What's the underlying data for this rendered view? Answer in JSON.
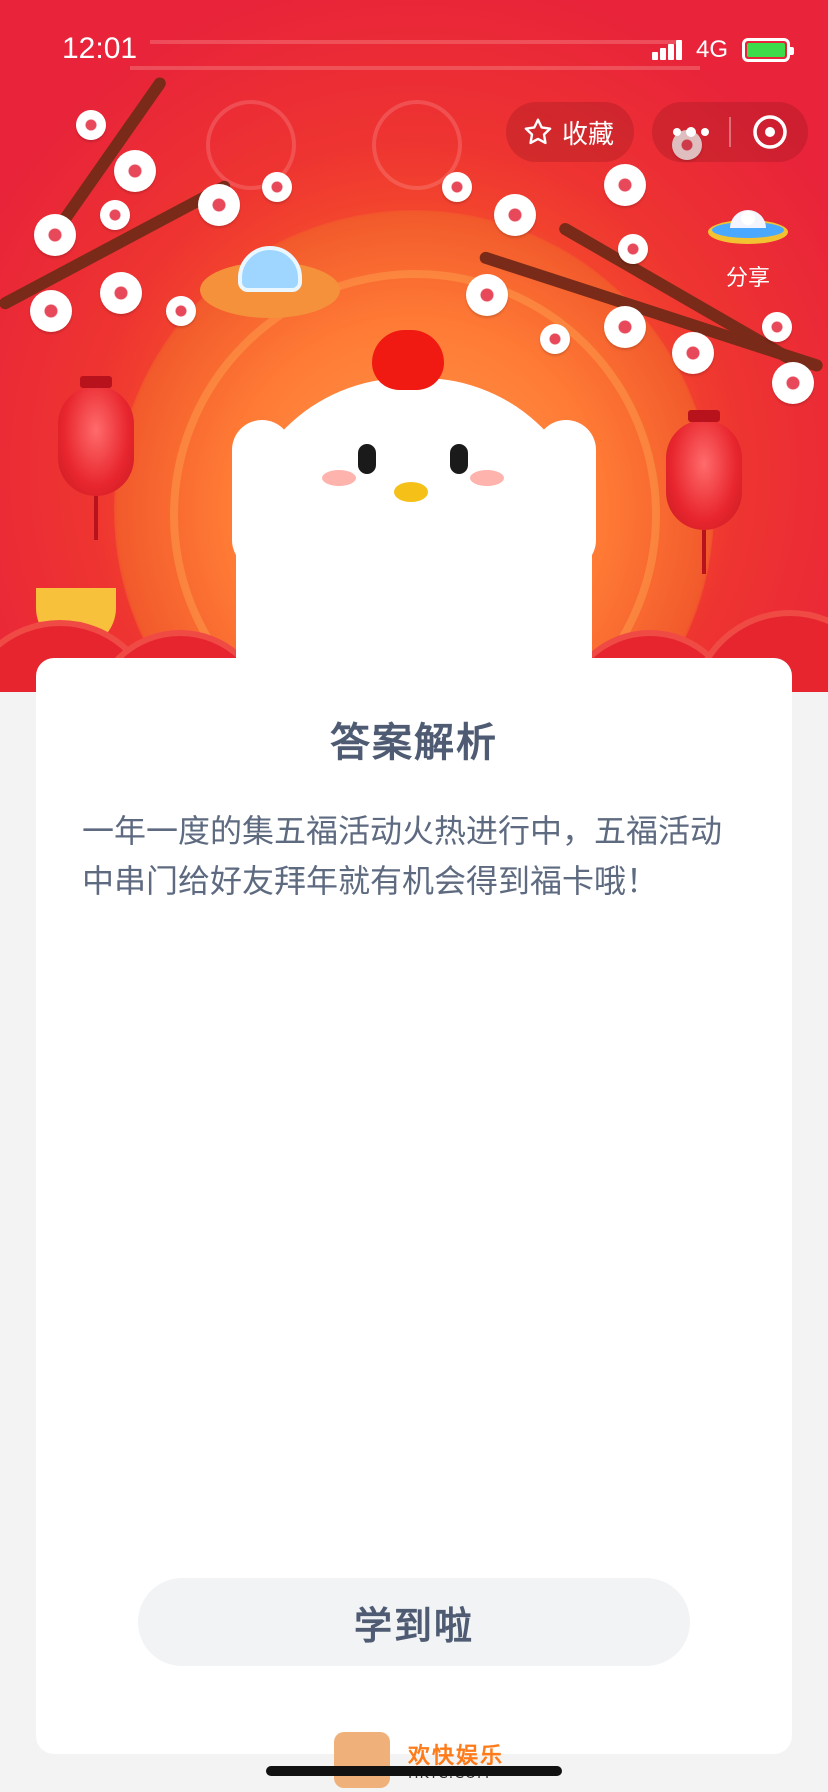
{
  "status_bar": {
    "time": "12:01",
    "network": "4G"
  },
  "header": {
    "favorite_label": "收藏",
    "share_label": "分享",
    "icons": [
      "star-icon",
      "more-icon",
      "close-icon",
      "share-icon",
      "signal-icon",
      "battery-icon"
    ]
  },
  "card": {
    "title": "答案解析",
    "body": "一年一度的集五福活动火热进行中，五福活动中串门给好友拜年就有机会得到福卡哦！",
    "button_label": "学到啦"
  },
  "watermark": {
    "text": "欢快娱乐",
    "sub": "HKYC.COM"
  },
  "colors": {
    "header_red": "#e8233a",
    "text_primary": "#4e5b72",
    "button_bg": "#f2f3f5",
    "page_bg": "#f3f3f3"
  }
}
